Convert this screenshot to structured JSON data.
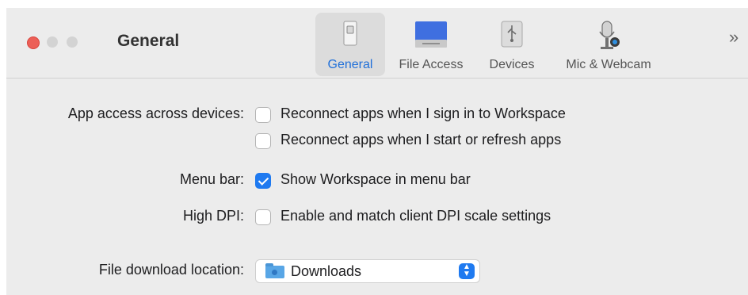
{
  "window": {
    "title": "General"
  },
  "toolbar": {
    "tabs": [
      {
        "label": "General",
        "icon": "general-switch-icon",
        "active": true
      },
      {
        "label": "File Access",
        "icon": "hard-drive-icon",
        "active": false
      },
      {
        "label": "Devices",
        "icon": "usb-icon",
        "active": false
      },
      {
        "label": "Mic & Webcam",
        "icon": "microphone-webcam-icon",
        "active": false
      }
    ],
    "overflow": "»"
  },
  "settings": {
    "app_access_label": "App access across devices:",
    "reconnect_signin": {
      "label": "Reconnect apps when I sign in to Workspace",
      "checked": false
    },
    "reconnect_refresh": {
      "label": "Reconnect apps when I start or refresh apps",
      "checked": false
    },
    "menu_bar_label": "Menu bar:",
    "show_in_menu_bar": {
      "label": "Show Workspace in menu bar",
      "checked": true
    },
    "high_dpi_label": "High DPI:",
    "match_dpi": {
      "label": "Enable and match client DPI scale settings",
      "checked": false
    },
    "download_location_label": "File download location:",
    "download_location": {
      "value": "Downloads",
      "icon": "folder-icon"
    }
  },
  "colors": {
    "accent": "#1f7af0",
    "active_tab_text": "#1f6fd9",
    "close_button": "#ec5f57"
  }
}
